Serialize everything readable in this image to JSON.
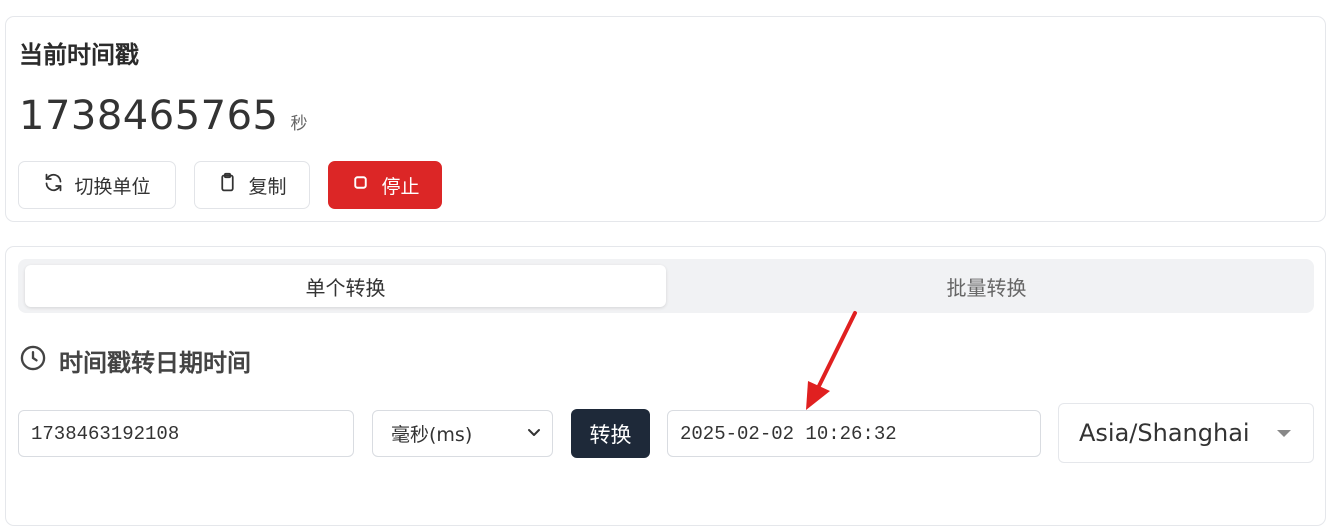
{
  "current": {
    "title": "当前时间戳",
    "timestamp": "1738465765",
    "unit": "秒",
    "buttons": {
      "switch_unit": "切换单位",
      "copy": "复制",
      "stop": "停止"
    }
  },
  "tabs": {
    "single": "单个转换",
    "batch": "批量转换",
    "active": "single"
  },
  "converter": {
    "title": "时间戳转日期时间",
    "input_value": "1738463192108",
    "unit_selected": "毫秒(ms)",
    "convert_label": "转换",
    "output_value": "2025-02-02 10:26:32",
    "timezone": "Asia/Shanghai"
  },
  "colors": {
    "stop_button": "#dc2626",
    "convert_button": "#1e2939",
    "annotation_arrow": "#e02020"
  },
  "icons": {
    "switch_unit": "refresh-icon",
    "copy": "clipboard-icon",
    "stop": "square-icon",
    "converter": "clock-icon",
    "unit_select": "chevron-down-icon",
    "timezone": "caret-down-icon"
  }
}
